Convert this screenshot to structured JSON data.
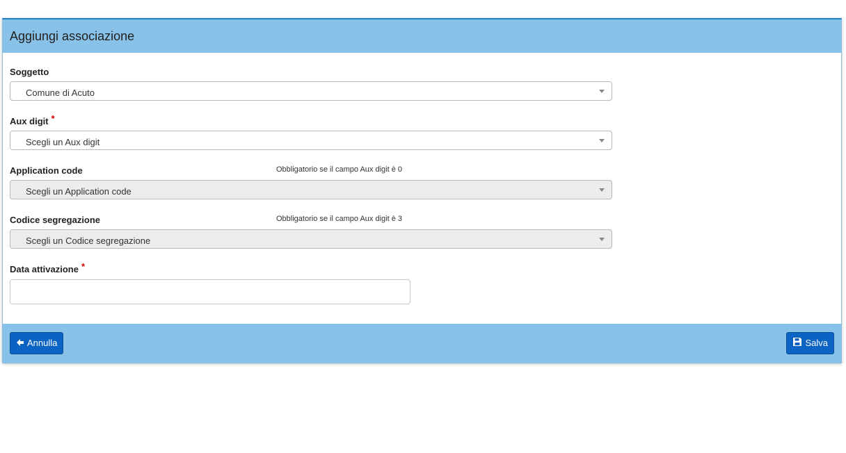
{
  "panel": {
    "title": "Aggiungi associazione"
  },
  "fields": {
    "soggetto": {
      "label": "Soggetto",
      "value": "Comune di Acuto"
    },
    "aux_digit": {
      "label": "Aux digit",
      "required_mark": "*",
      "value": "Scegli un Aux digit"
    },
    "application_code": {
      "label": "Application code",
      "hint": "Obbligatorio se il campo Aux digit è 0",
      "value": "Scegli un Application code"
    },
    "codice_segregazione": {
      "label": "Codice segregazione",
      "hint": "Obbligatorio se il campo Aux digit è 3",
      "value": "Scegli un Codice segregazione"
    },
    "data_attivazione": {
      "label": "Data attivazione",
      "required_mark": "*",
      "value": ""
    }
  },
  "footer": {
    "cancel_label": "Annulla",
    "save_label": "Salva"
  },
  "colors": {
    "header_bg": "#89c2e8",
    "button_bg": "#0b63c4",
    "required": "#d10000"
  }
}
